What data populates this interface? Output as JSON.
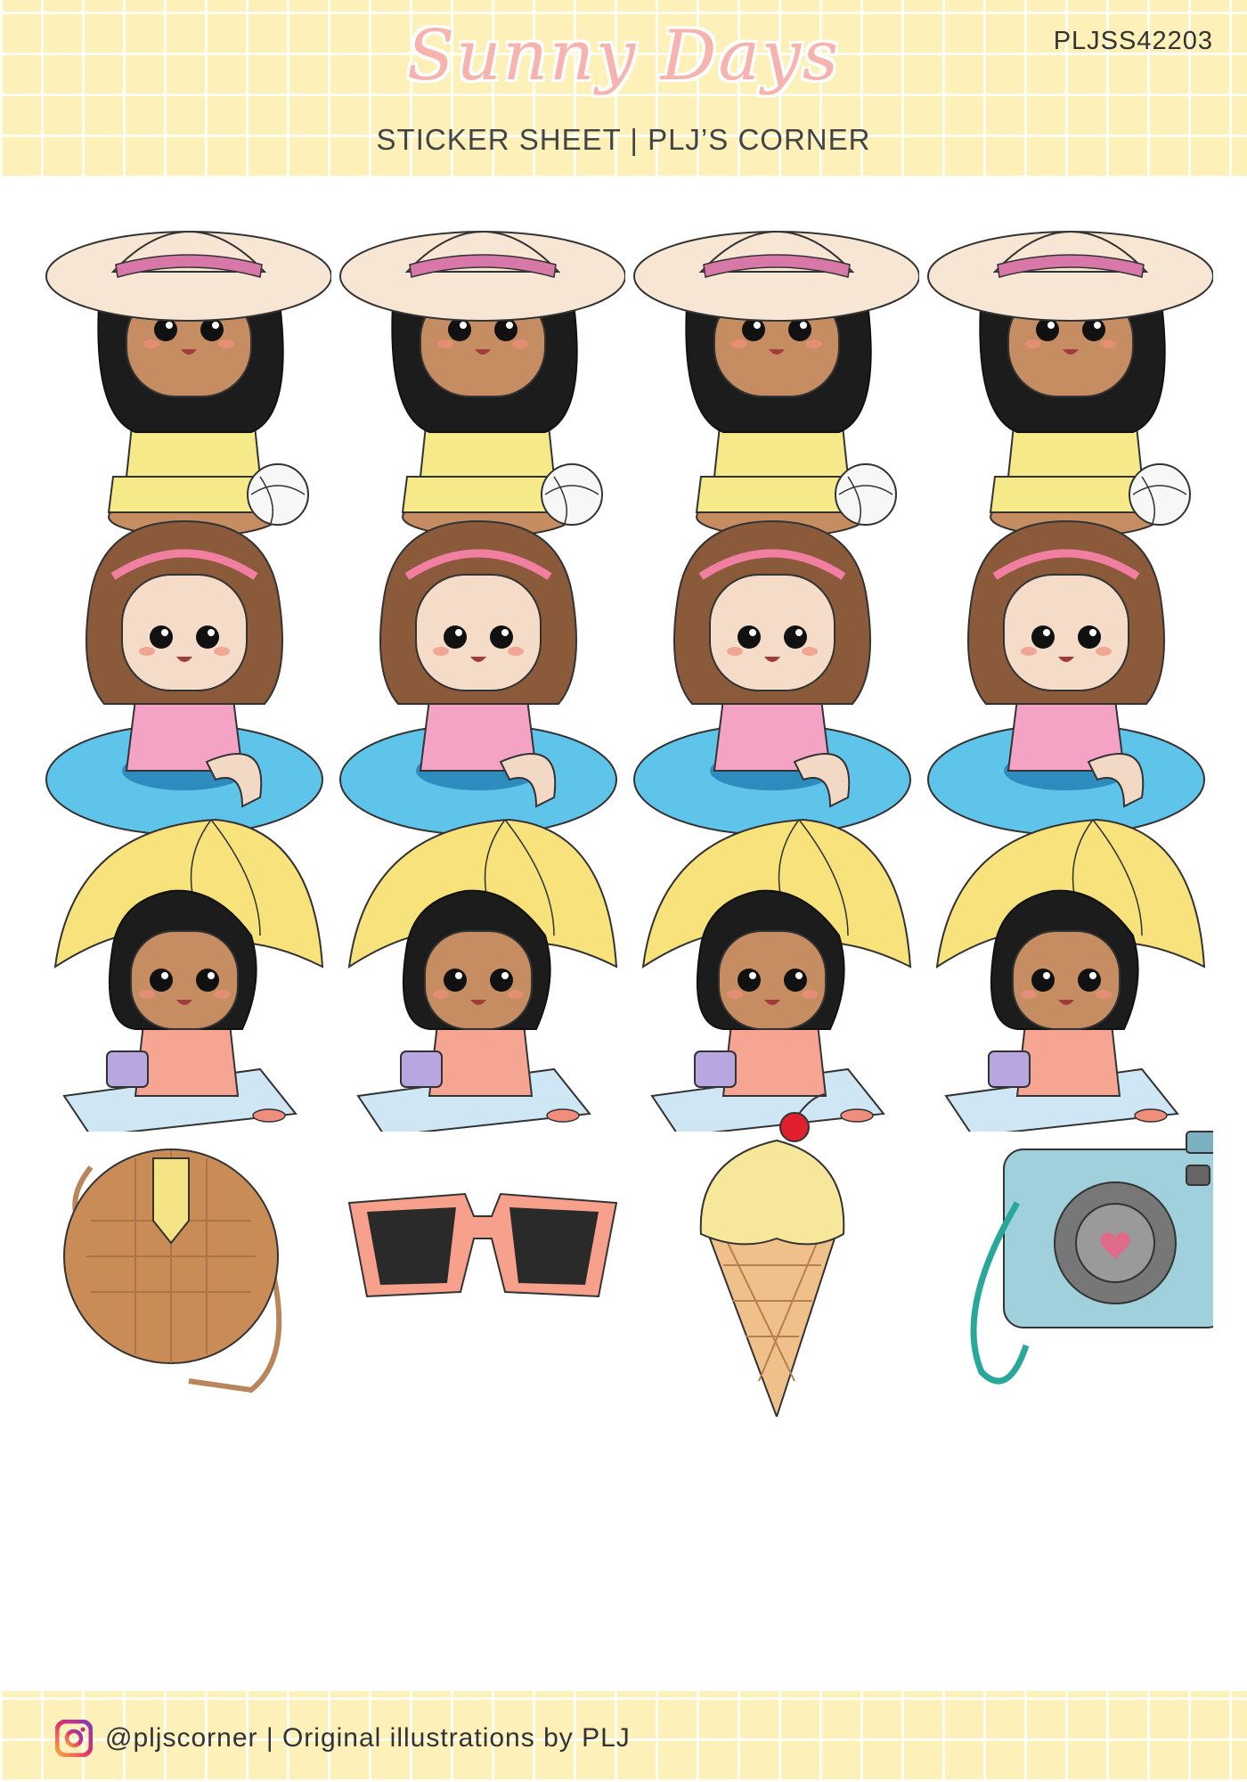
{
  "header": {
    "title": "Sunny Days",
    "subtitle": "STICKER SHEET | PLJ’S CORNER",
    "code": "PLJSS42203"
  },
  "footer": {
    "icon": "instagram-icon",
    "text": "@pljscorner | Original illustrations by PLJ"
  },
  "colors": {
    "band": "#fdf0b8",
    "title": "#f7b3ad",
    "text": "#444444"
  },
  "stickers": [
    {
      "row": "hat-girl",
      "count": 4
    },
    {
      "row": "float-girl",
      "count": 4
    },
    {
      "row": "umbrella-girl",
      "count": 4
    },
    {
      "row": "accessories",
      "items": [
        "straw-bag",
        "sunglasses",
        "ice-cream",
        "camera"
      ]
    }
  ]
}
